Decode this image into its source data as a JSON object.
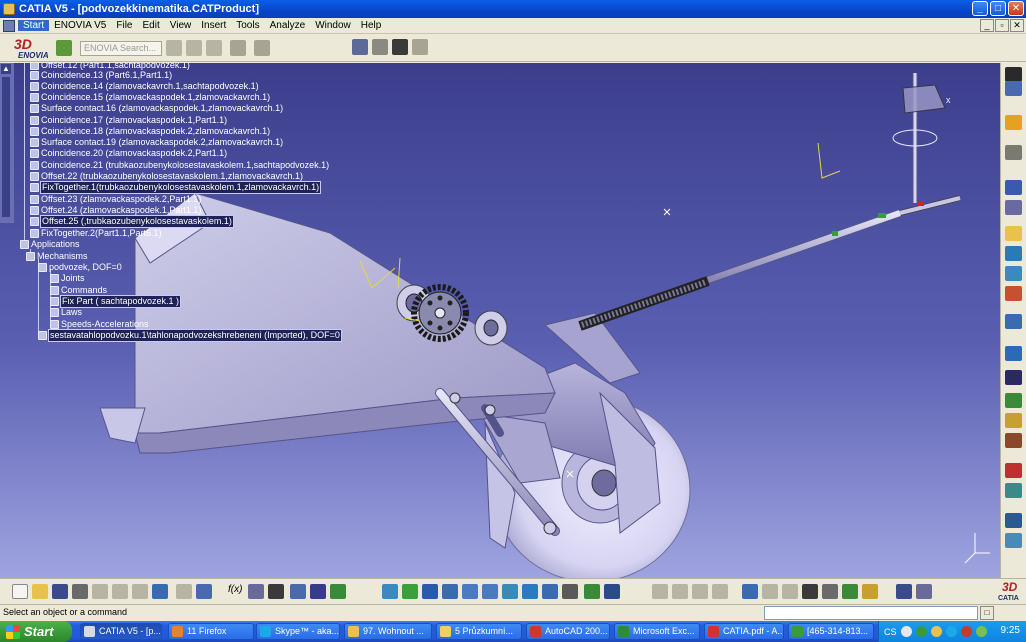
{
  "window": {
    "title": "CATIA V5 - [podvozekkinematika.CATProduct]",
    "buttons": {
      "minimize": "_",
      "maximize": "□",
      "close": "✕"
    }
  },
  "menubar": {
    "items": [
      "Start",
      "ENOVIA V5",
      "File",
      "Edit",
      "View",
      "Insert",
      "Tools",
      "Analyze",
      "Window",
      "Help"
    ],
    "mdi_buttons": [
      "_",
      "▫",
      "✕"
    ]
  },
  "toolbar_top": {
    "logo_ds": "3D",
    "logo_text": "ENOVIA",
    "search_placeholder": "ENOVIA Search..."
  },
  "tree": {
    "items": [
      {
        "label": "Offset.12 (Part1.1,sachtapodvozek.1)",
        "selected": false
      },
      {
        "label": "Coincidence.13 (Part6.1,Part1.1)",
        "selected": false
      },
      {
        "label": "Coincidence.14 (zlamovackavrch.1,sachtapodvozek.1)",
        "selected": false
      },
      {
        "label": "Coincidence.15 (zlamovackaspodek.1,zlamovackavrch.1)",
        "selected": false
      },
      {
        "label": "Surface contact.16 (zlamovackaspodek.1,zlamovackavrch.1)",
        "selected": false
      },
      {
        "label": "Coincidence.17 (zlamovackaspodek.1,Part1.1)",
        "selected": false
      },
      {
        "label": "Coincidence.18 (zlamovackaspodek.2,zlamovackavrch.1)",
        "selected": false
      },
      {
        "label": "Surface contact.19 (zlamovackaspodek.2,zlamovackavrch.1)",
        "selected": false
      },
      {
        "label": "Coincidence.20 (zlamovackaspodek.2,Part1.1)",
        "selected": false
      },
      {
        "label": "Coincidence.21 (trubkaozubenykolosestavaskolem.1,sachtapodvozek.1)",
        "selected": false
      },
      {
        "label": "Offset.22 (trubkaozubenykolosestavaskolem.1,zlamovackavrch.1)",
        "selected": false
      },
      {
        "label": "FixTogether.1(trubkaozubenykolosestavaskolem.1,zlamovackavrch.1)",
        "selected": true
      },
      {
        "label": "Offset.23 (zlamovackaspodek.2,Part1.1)",
        "selected": false
      },
      {
        "label": "Offset.24 (zlamovackaspodek.1,Part1.1)",
        "selected": false
      },
      {
        "label": "Offset.25 (,trubkaozubenykolosestavaskolem.1)",
        "selected": true
      },
      {
        "label": "FixTogether.2(Part1.1,Part6.1)",
        "selected": false
      },
      {
        "label": "Applications",
        "selected": false
      },
      {
        "label": "Mechanisms",
        "selected": false
      },
      {
        "label": "podvozek, DOF=0",
        "selected": false
      },
      {
        "label": "Joints",
        "selected": false
      },
      {
        "label": "Commands",
        "selected": false
      },
      {
        "label": "Fix Part ( sachtapodvozek.1 )",
        "selected": true
      },
      {
        "label": "Laws",
        "selected": false
      },
      {
        "label": "Speeds-Accelerations",
        "selected": false
      },
      {
        "label": "sestavatahlopodvozku.1\\tahlonapodvozekshrebeneni (Imported), DOF=0",
        "selected": true
      }
    ]
  },
  "model": {
    "axis_label_x": "x"
  },
  "bottom_toolbar": {
    "fx_label": "f(x)",
    "logo_ds": "3D",
    "logo_text": "CATIA"
  },
  "status": {
    "message": "Select an object or a command"
  },
  "taskbar": {
    "start_label": "Start",
    "tasks": [
      {
        "label": "CATIA V5 - [p...",
        "color": "#D8D8E8"
      },
      {
        "label": "11 Firefox",
        "color": "#E8832A"
      },
      {
        "label": "Skype™ - aka...",
        "color": "#1BA9E8"
      },
      {
        "label": "97. Wohnout ...",
        "color": "#E8C24A"
      },
      {
        "label": "5 Průzkumní...",
        "color": "#F0D060"
      },
      {
        "label": "AutoCAD 200...",
        "color": "#C83A2A"
      },
      {
        "label": "Microsoft Exc...",
        "color": "#2E8B3A"
      },
      {
        "label": "CATIA.pdf - A...",
        "color": "#D83030"
      },
      {
        "label": "[465-314-813...",
        "color": "#3A9B3A"
      }
    ],
    "language": "CS",
    "clock": "9:25"
  },
  "colors": {
    "viewport_top": "#3C3E8C",
    "viewport_bottom": "#9FA4E0",
    "titlebar": "#0A5FE8",
    "taskbar": "#245EDC",
    "start_button": "#3A9B3A"
  }
}
